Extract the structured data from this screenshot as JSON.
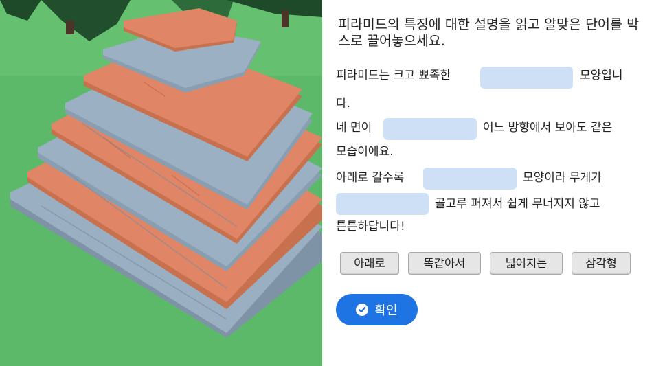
{
  "instruction": "피라미드의 특징에 대한 설명을 읽고 알맞은 단어를 박스로 끌어놓으세요.",
  "sentences": {
    "s1_before": "피라미드는 크고 뾰족한",
    "s1_after": "모양입니",
    "s1_wrap": "다.",
    "s2_before": "네 면이",
    "s2_after": "어느 방향에서 보아도 같은",
    "s2_wrap": "모습이에요.",
    "s3_before": "아래로 갈수록",
    "s3_after": "모양이라 무게가",
    "s3_line2": "골고루 퍼져서 쉽게 무너지지 않고",
    "s3_wrap": "튼튼하답니다!"
  },
  "word_bank": [
    "아래로",
    "똑같아서",
    "넓어지는",
    "삼각형"
  ],
  "confirm_button": {
    "label": "확인",
    "icon": "check-circle-icon",
    "color": "#1f74e4"
  },
  "colors": {
    "blank": "#cde0f6",
    "grass": "#5cb96a",
    "orange_layer": "#e08566",
    "blue_layer": "#93a9bd"
  }
}
